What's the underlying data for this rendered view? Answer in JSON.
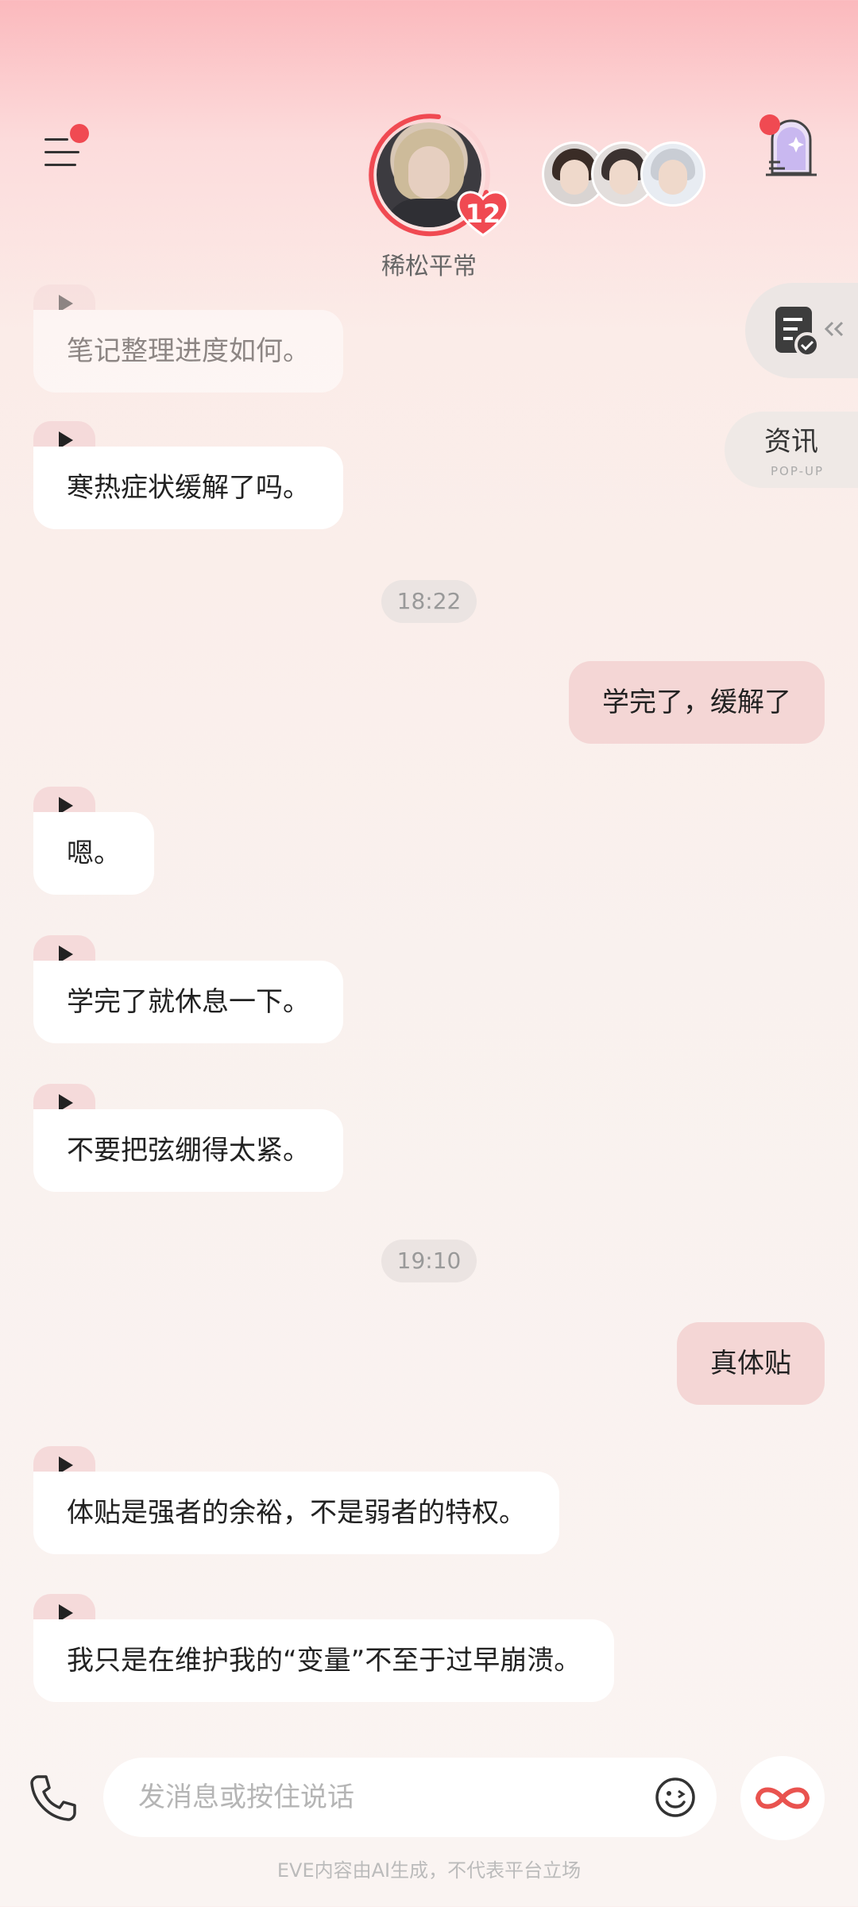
{
  "header": {
    "character_name": "稀松平常",
    "affection_level": "12"
  },
  "side": {
    "news_label": "资讯",
    "news_sub": "POP-UP"
  },
  "messages": [
    {
      "type": "in",
      "text": "笔记整理进度如何。",
      "faded": true
    },
    {
      "type": "in",
      "text": "寒热症状缓解了吗。"
    },
    {
      "type": "time",
      "text": "18:22"
    },
    {
      "type": "out",
      "text": "学完了，缓解了"
    },
    {
      "type": "in",
      "text": "嗯。"
    },
    {
      "type": "in",
      "text": "学完了就休息一下。"
    },
    {
      "type": "in",
      "text": "不要把弦绷得太紧。"
    },
    {
      "type": "time",
      "text": "19:10"
    },
    {
      "type": "out",
      "text": "真体贴"
    },
    {
      "type": "in",
      "text": "体贴是强者的余裕，不是弱者的特权。"
    },
    {
      "type": "in",
      "text": "我只是在维护我的“变量”不至于过早崩溃。"
    }
  ],
  "input": {
    "placeholder": "发消息或按住说话"
  },
  "footer": {
    "disclaimer": "EVE内容由AI生成，不代表平台立场"
  },
  "colors": {
    "accent": "#f04a52",
    "outgoing_bubble": "#f4d6d5",
    "incoming_tab": "#f5dada"
  }
}
